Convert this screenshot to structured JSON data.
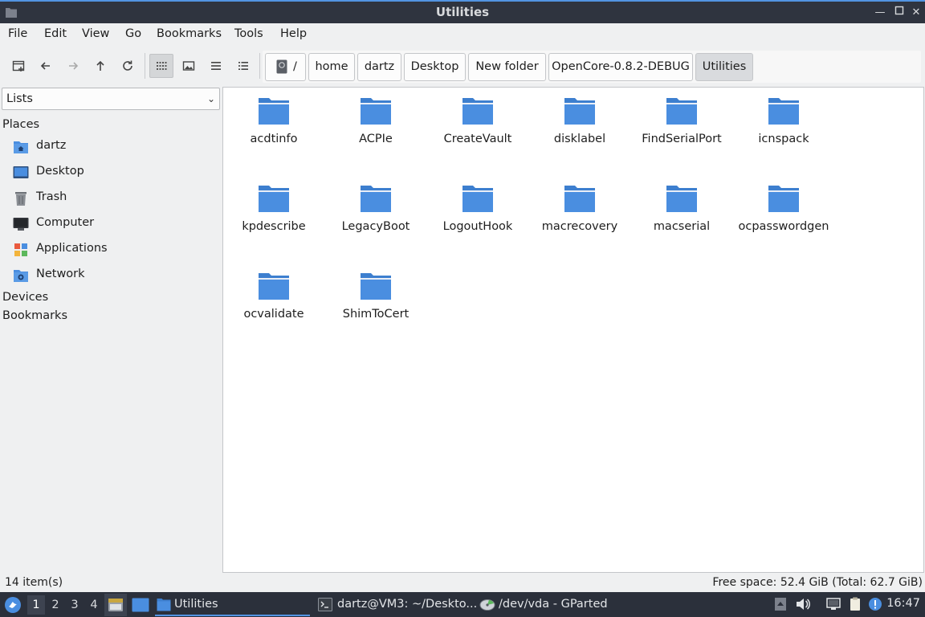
{
  "window": {
    "title": "Utilities"
  },
  "menu": [
    "File",
    "Edit",
    "View",
    "Go",
    "Bookmarks",
    "Tools",
    "Help"
  ],
  "breadcrumbs": [
    "/",
    "home",
    "dartz",
    "Desktop",
    "New folder",
    "OpenCore-0.8.2-DEBUG",
    "Utilities"
  ],
  "sidebar": {
    "panel_select": "Lists",
    "places_label": "Places",
    "places": [
      {
        "label": "dartz",
        "icon": "home-folder-icon"
      },
      {
        "label": "Desktop",
        "icon": "desktop-icon"
      },
      {
        "label": "Trash",
        "icon": "trash-icon"
      },
      {
        "label": "Computer",
        "icon": "computer-icon"
      },
      {
        "label": "Applications",
        "icon": "applications-icon"
      },
      {
        "label": "Network",
        "icon": "network-icon"
      }
    ],
    "devices_label": "Devices",
    "bookmarks_label": "Bookmarks"
  },
  "files": [
    "acdtinfo",
    "ACPIe",
    "CreateVault",
    "disklabel",
    "FindSerialPort",
    "icnspack",
    "kpdescribe",
    "LegacyBoot",
    "LogoutHook",
    "macrecovery",
    "macserial",
    "ocpasswordgen",
    "ocvalidate",
    "ShimToCert"
  ],
  "status": {
    "items": "14 item(s)",
    "free_space": "Free space: 52.4 GiB (Total: 62.7 GiB)"
  },
  "taskbar": {
    "desktops": [
      "1",
      "2",
      "3",
      "4"
    ],
    "active_desktop": "1",
    "tasks": [
      {
        "label": "Utilities",
        "icon": "folder-icon"
      },
      {
        "label": "dartz@VM3: ~/Deskto...",
        "icon": "terminal-icon"
      },
      {
        "label": "/dev/vda - GParted",
        "icon": "gparted-icon"
      }
    ],
    "clock": "16:47"
  },
  "colors": {
    "accent": "#5294e2",
    "folder": "#4a8ee0",
    "titlebar": "#2f343f",
    "taskbar": "#2b303b"
  }
}
